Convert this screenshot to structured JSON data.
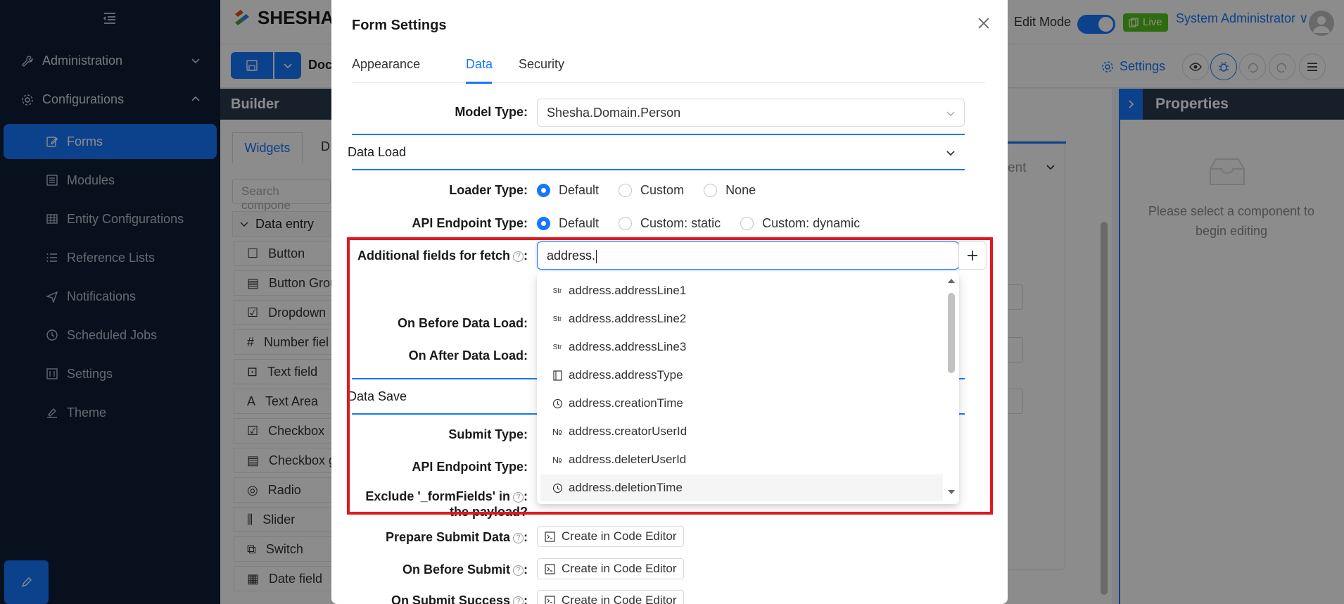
{
  "app": {
    "logo_text": "SHESHA",
    "edit_mode_label": "Edit Mode",
    "live_label": "Live",
    "user_name": "System Administrator"
  },
  "sidebar": {
    "groups": [
      {
        "label": "Administration",
        "icon": "tool-icon"
      },
      {
        "label": "Configurations",
        "icon": "gear-icon"
      }
    ],
    "items": [
      {
        "label": "Forms",
        "icon": "edit-icon",
        "active": true
      },
      {
        "label": "Modules",
        "icon": "module-icon"
      },
      {
        "label": "Entity Configurations",
        "icon": "table-icon"
      },
      {
        "label": "Reference Lists",
        "icon": "list-icon"
      },
      {
        "label": "Notifications",
        "icon": "send-icon"
      },
      {
        "label": "Scheduled Jobs",
        "icon": "clock-icon"
      },
      {
        "label": "Settings",
        "icon": "sliders-icon"
      },
      {
        "label": "Theme",
        "icon": "paint-icon"
      }
    ]
  },
  "toolbar": {
    "doc_label": "Docu",
    "settings_label": "Settings"
  },
  "builder": {
    "title": "Builder Widgets",
    "tab_widgets": "Widgets",
    "tab_other": "D",
    "search_placeholder": "Search compone",
    "group_label": "Data entry",
    "widgets": [
      "Button",
      "Button Grou",
      "Dropdown",
      "Number fiel",
      "Text field",
      "Text Area",
      "Checkbox",
      "Checkbox g",
      "Radio",
      "Slider",
      "Switch",
      "Date field"
    ]
  },
  "canvas": {
    "partial_label": "ent"
  },
  "properties": {
    "title": "Properties",
    "empty_text": "Please select a component to begin editing"
  },
  "modal": {
    "title": "Form Settings",
    "tabs": [
      "Appearance",
      "Data",
      "Security"
    ],
    "active_tab": "Data",
    "model_type_label": "Model Type",
    "model_type_value": "Shesha.Domain.Person",
    "data_load_section": "Data Load",
    "loader_type_label": "Loader Type",
    "loader_type_options": [
      "Default",
      "Custom",
      "None"
    ],
    "api_endpoint_label": "API Endpoint Type",
    "api_endpoint_options": [
      "Default",
      "Custom: static",
      "Custom: dynamic"
    ],
    "additional_fields_label": "Additional fields for fetch",
    "additional_fields_value": "address.",
    "on_before_load_label": "On Before Data Load",
    "on_after_load_label": "On After Data Load",
    "data_save_section": "Data Save",
    "submit_type_label": "Submit Type",
    "api_endpoint_save_label": "API Endpoint Type",
    "exclude_label_line1": "Exclude '_formFields' in",
    "exclude_label_line2": "the payload?",
    "prepare_submit_label": "Prepare Submit Data",
    "on_before_submit_label": "On Before Submit",
    "on_submit_success_label": "On Submit Success",
    "code_editor_label": "Create in Code Editor"
  },
  "autocomplete": {
    "options": [
      {
        "type_glyph": "Str",
        "label": "address.addressLine1"
      },
      {
        "type_glyph": "Str",
        "label": "address.addressLine2"
      },
      {
        "type_glyph": "Str",
        "label": "address.addressLine3"
      },
      {
        "type_glyph": "book",
        "label": "address.addressType"
      },
      {
        "type_glyph": "clock",
        "label": "address.creationTime"
      },
      {
        "type_glyph": "№",
        "label": "address.creatorUserId"
      },
      {
        "type_glyph": "№",
        "label": "address.deleterUserId"
      },
      {
        "type_glyph": "clock",
        "label": "address.deletionTime"
      }
    ],
    "highlighted_index": 7
  },
  "colors": {
    "primary": "#1677ff",
    "sidebar_bg": "#0f1e36",
    "highlight_border": "#e0181f",
    "live": "#52c41a"
  }
}
